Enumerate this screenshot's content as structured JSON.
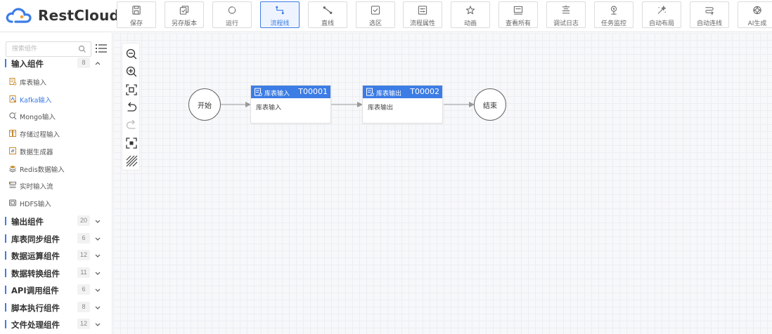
{
  "brand": {
    "name": "RestCloud",
    "color": "#3c7ce5"
  },
  "toolbar": [
    {
      "label": "保存",
      "icon": "save-icon"
    },
    {
      "label": "另存版本",
      "icon": "save-version-icon"
    },
    {
      "label": "运行",
      "icon": "run-icon"
    },
    {
      "label": "流程线",
      "icon": "flow-line-icon",
      "active": true
    },
    {
      "label": "直线",
      "icon": "straight-line-icon"
    },
    {
      "label": "选区",
      "icon": "selection-icon"
    },
    {
      "label": "流程属性",
      "icon": "flow-properties-icon"
    },
    {
      "label": "动画",
      "icon": "animation-icon"
    },
    {
      "label": "查看所有",
      "icon": "view-all-icon"
    },
    {
      "label": "调试日志",
      "icon": "debug-log-icon"
    },
    {
      "label": "任务监控",
      "icon": "task-monitor-icon"
    },
    {
      "label": "自动布局",
      "icon": "auto-layout-icon"
    },
    {
      "label": "自动连线",
      "icon": "auto-connect-icon"
    },
    {
      "label": "AI生成",
      "icon": "ai-generate-icon"
    }
  ],
  "sidebar": {
    "search_placeholder": "搜索组件",
    "groups": [
      {
        "name": "输入组件",
        "count": "8",
        "expanded": true,
        "items": [
          {
            "name": "库表输入",
            "icon": "db-table-icon"
          },
          {
            "name": "Kafka输入",
            "icon": "kafka-icon",
            "active": true
          },
          {
            "name": "Mongo输入",
            "icon": "mongo-icon"
          },
          {
            "name": "存储过程输入",
            "icon": "stored-procedure-icon"
          },
          {
            "name": "数据生成器",
            "icon": "data-generator-icon"
          },
          {
            "name": "Redis数据输入",
            "icon": "redis-icon"
          },
          {
            "name": "实时输入流",
            "icon": "stream-icon"
          },
          {
            "name": "HDFS输入",
            "icon": "hdfs-icon"
          }
        ]
      },
      {
        "name": "输出组件",
        "count": "20",
        "expanded": false
      },
      {
        "name": "库表同步组件",
        "count": "6",
        "expanded": false
      },
      {
        "name": "数据运算组件",
        "count": "12",
        "expanded": false
      },
      {
        "name": "数据转换组件",
        "count": "11",
        "expanded": false
      },
      {
        "name": "API调用组件",
        "count": "6",
        "expanded": false
      },
      {
        "name": "脚本执行组件",
        "count": "8",
        "expanded": false
      },
      {
        "name": "文件处理组件",
        "count": "12",
        "expanded": false
      }
    ]
  },
  "canvas": {
    "zoom_tools": [
      "zoom-out-icon",
      "zoom-in-icon",
      "fit-view-icon",
      "undo-icon",
      "redo-icon",
      "fullscreen-icon",
      "grid-toggle-icon"
    ],
    "start_label": "开始",
    "end_label": "结束",
    "nodes": [
      {
        "title": "库表输入",
        "id": "T00001",
        "body": "库表输入"
      },
      {
        "title": "库表输出",
        "id": "T00002",
        "body": "库表输出"
      }
    ]
  }
}
